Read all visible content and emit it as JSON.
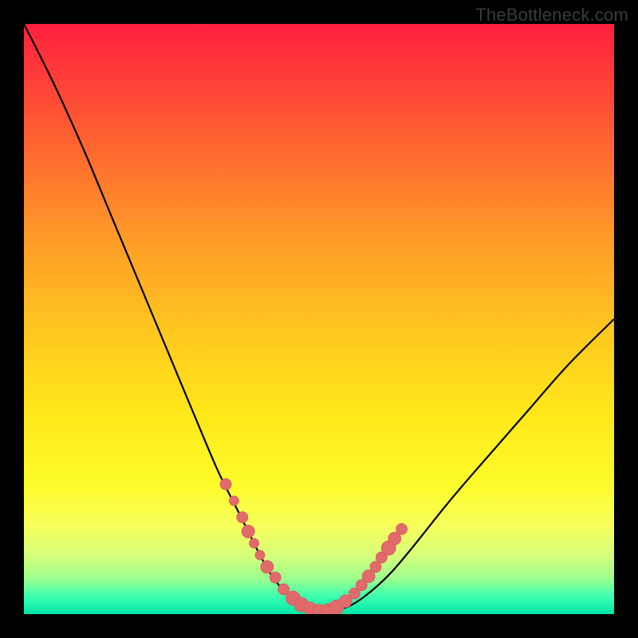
{
  "watermark": "TheBottleneck.com",
  "colors": {
    "frame": "#000000",
    "curve": "#000000",
    "marker_fill": "#e16a6a",
    "marker_stroke": "#d75c5c"
  },
  "chart_data": {
    "type": "line",
    "title": "",
    "xlabel": "",
    "ylabel": "",
    "xlim": [
      0,
      100
    ],
    "ylim": [
      0,
      100
    ],
    "grid": false,
    "series": [
      {
        "name": "bottleneck-curve",
        "x": [
          0,
          5,
          10,
          15,
          20,
          25,
          30,
          33,
          36,
          38,
          40,
          42,
          44,
          46,
          48,
          50,
          52,
          55,
          58,
          62,
          66,
          72,
          78,
          85,
          92,
          100
        ],
        "y": [
          100,
          90,
          79,
          67,
          55,
          43,
          31,
          24,
          18,
          14,
          10,
          6.5,
          4,
          2.2,
          1.1,
          0.6,
          0.6,
          1.3,
          3.2,
          6.8,
          11.5,
          19,
          26,
          34,
          42,
          50
        ]
      }
    ],
    "markers": {
      "name": "highlight-points",
      "x": [
        34.2,
        35.6,
        37.0,
        38.0,
        39.0,
        40.0,
        41.2,
        42.6,
        44.0,
        45.6,
        47.0,
        48.4,
        50.0,
        51.6,
        53.0,
        54.5,
        56.0,
        57.2,
        58.4,
        59.6,
        60.6,
        61.8,
        62.8,
        64.0
      ],
      "y": [
        22.0,
        19.2,
        16.4,
        14.0,
        12.0,
        10.0,
        8.0,
        6.2,
        4.2,
        2.7,
        1.6,
        1.0,
        0.6,
        0.7,
        1.2,
        2.2,
        3.5,
        4.9,
        6.4,
        8.0,
        9.6,
        11.2,
        12.8,
        14.4
      ],
      "r": [
        7,
        6,
        7,
        8,
        6,
        6,
        8,
        7,
        7,
        9,
        9,
        8,
        8,
        8,
        9,
        8,
        7,
        7,
        8,
        7,
        7,
        9,
        8,
        7
      ]
    }
  }
}
